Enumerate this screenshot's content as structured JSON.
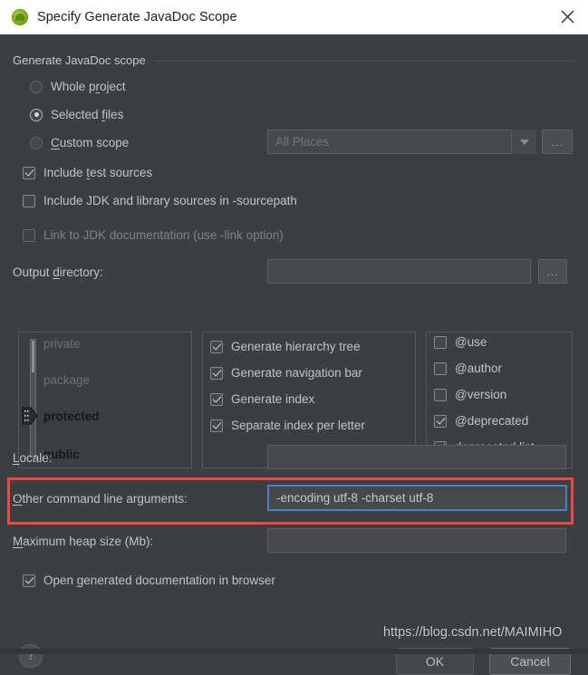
{
  "window": {
    "title": "Specify Generate JavaDoc Scope",
    "app_icon": "javadoc-app-icon",
    "close_icon": "close-icon"
  },
  "scope_group": {
    "title": "Generate JavaDoc scope",
    "options": [
      {
        "label_before": "Whole p",
        "mnemonic": "r",
        "label_after": "oject",
        "selected": false
      },
      {
        "label_before": "Selected ",
        "mnemonic": "f",
        "label_after": "iles",
        "selected": true
      },
      {
        "label_before": "",
        "mnemonic": "C",
        "label_after": "ustom scope",
        "selected": false
      }
    ],
    "custom_scope_combo": {
      "value": "All Places",
      "is_placeholder": true,
      "dropdown_icon": "chevron-down-icon",
      "browse_label": "..."
    }
  },
  "checkboxes": [
    {
      "label_before": "Include ",
      "mnemonic": "t",
      "label_after": "est sources",
      "checked": true,
      "disabled": false
    },
    {
      "label_before": "Include JDK and library sources in -sourcepath",
      "mnemonic": "",
      "label_after": "",
      "checked": false,
      "disabled": false
    },
    {
      "label_before": "Link to JDK documentation (use -link option)",
      "mnemonic": "",
      "label_after": "",
      "checked": false,
      "disabled": true
    }
  ],
  "output_directory": {
    "label_before": "Output ",
    "mnemonic": "d",
    "label_after": "irectory:",
    "value": "",
    "browse_label": "..."
  },
  "visibility_slider": {
    "levels": [
      "private",
      "package",
      "protected",
      "public"
    ],
    "selected": "protected",
    "thumb_icon": "slider-thumb-icon"
  },
  "generate_options": [
    {
      "label": "Generate hierarchy tree",
      "checked": true
    },
    {
      "label": "Generate navigation bar",
      "checked": true
    },
    {
      "label": "Generate index",
      "checked": true
    },
    {
      "label": "Separate index per letter",
      "checked": true
    }
  ],
  "tag_options": [
    {
      "label": "@use",
      "checked": false
    },
    {
      "label": "@author",
      "checked": false
    },
    {
      "label": "@version",
      "checked": false
    },
    {
      "label": "@deprecated",
      "checked": true
    },
    {
      "label": "deprecated list",
      "checked": true
    }
  ],
  "locale": {
    "label_before": "",
    "mnemonic": "L",
    "label_after": "ocale:",
    "value": ""
  },
  "other_args": {
    "label_before": "",
    "mnemonic": "O",
    "label_after": "ther command line arguments:",
    "value": "-encoding utf-8 -charset utf-8",
    "focused": true
  },
  "max_heap": {
    "label_before": "",
    "mnemonic": "M",
    "label_after": "aximum heap size (Mb):",
    "value": ""
  },
  "open_in_browser": {
    "label_before": "Open ",
    "mnemonic": "g",
    "label_after": "enerated documentation in browser",
    "checked": true
  },
  "footer": {
    "help_icon": "help-icon",
    "help_glyph": "?",
    "ok_label": "OK",
    "cancel_label": "Cancel"
  },
  "watermark": "https://blog.csdn.net/MAIMIHO",
  "colors": {
    "background": "#3c3f41",
    "titlebar": "#ffffff",
    "accent_focus": "#4a81c4",
    "annotation_red": "#f0473e",
    "help_blue": "#3592e0"
  }
}
